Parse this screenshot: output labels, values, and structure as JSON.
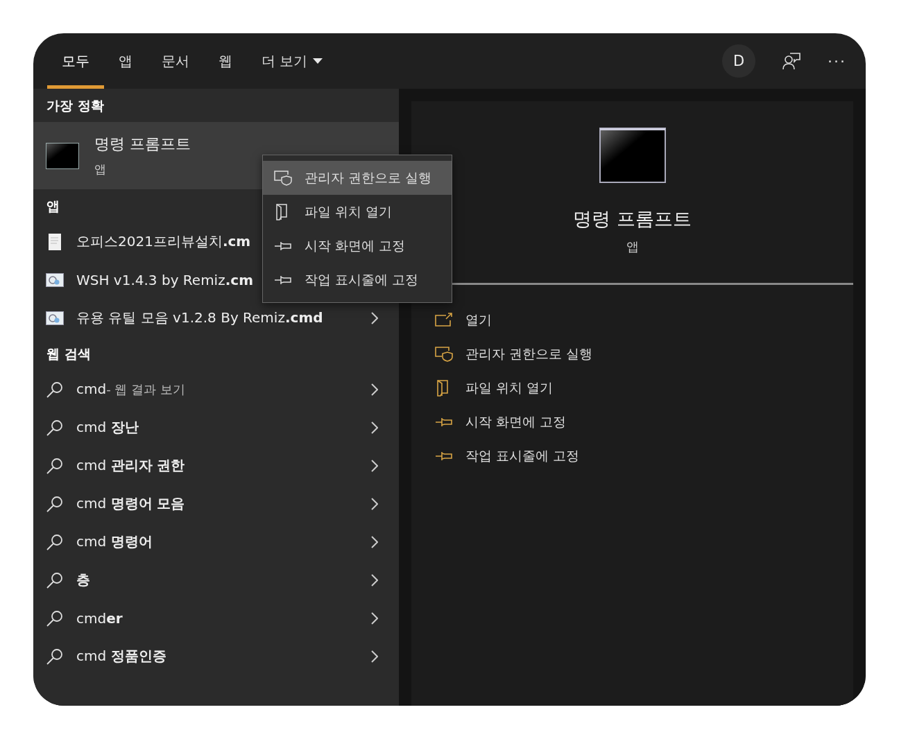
{
  "tabs": [
    {
      "label": "모두",
      "selected": true,
      "kind": "plain"
    },
    {
      "label": "앱",
      "selected": false,
      "kind": "plain"
    },
    {
      "label": "문서",
      "selected": false,
      "kind": "plain"
    },
    {
      "label": "웹",
      "selected": false,
      "kind": "plain"
    },
    {
      "label": "더 보기",
      "selected": false,
      "kind": "dropdown"
    }
  ],
  "account": {
    "initial": "D"
  },
  "more_menu": "···",
  "best_match": {
    "heading": "가장 정확",
    "title": "명령 프롬프트",
    "subtitle": "앱",
    "selected": true
  },
  "apps": {
    "heading": "앱",
    "items": [
      {
        "label": "오피스2021프리뷰설치**.cm**",
        "kind": "document",
        "has_arrow": false
      },
      {
        "label": "WSH v1.4.3 by Remiz**.cm**",
        "kind": "script",
        "has_arrow": false
      },
      {
        "label": "유용 유틸 모음 v1.2.8 By Remiz**.cmd**",
        "kind": "script",
        "has_arrow": true
      }
    ]
  },
  "web_search": {
    "heading": "웹 검색",
    "items": [
      {
        "label": "cmd",
        "suffix": "- 웹 결과 보기"
      },
      {
        "label": "cmd **장난**"
      },
      {
        "label": "cmd **관리자 권한**"
      },
      {
        "label": "cmd **명령어 모음**"
      },
      {
        "label": "cmd **명령어**"
      },
      {
        "label": "**층**"
      },
      {
        "label": "cmd**er**"
      },
      {
        "label": "cmd **정품인증**"
      }
    ]
  },
  "context_menu": [
    {
      "label": "관리자 권한으로 실행",
      "kind": "admin",
      "selected": true
    },
    {
      "label": "파일 위치 열기",
      "kind": "folder",
      "selected": false
    },
    {
      "label": "시작 화면에 고정",
      "kind": "pin",
      "selected": false
    },
    {
      "label": "작업 표시줄에 고정",
      "kind": "pin",
      "selected": false
    }
  ],
  "detail": {
    "title": "명령 프롬프트",
    "subtitle": "앱",
    "actions": [
      {
        "label": "열기",
        "kind": "open"
      },
      {
        "label": "관리자 권한으로 실행",
        "kind": "admin"
      },
      {
        "label": "파일 위치 열기",
        "kind": "folder"
      },
      {
        "label": "시작 화면에 고정",
        "kind": "pin"
      },
      {
        "label": "작업 표시줄에 고정",
        "kind": "pin"
      }
    ]
  }
}
